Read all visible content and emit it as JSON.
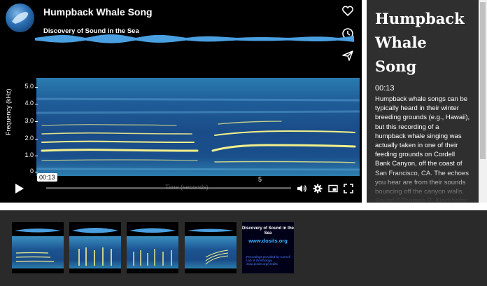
{
  "video": {
    "title": "Humpback Whale Song",
    "subtitle": "Discovery of Sound in the Sea",
    "y_axis_label": "Frequency (kHz)",
    "y_ticks": [
      "5.0",
      "4.0",
      "3.0",
      "2.0",
      "1.0",
      "0"
    ],
    "x_axis_label": "Time (seconds)",
    "x_tick": "5",
    "current_time": "00:13",
    "progress_fraction": 0.0
  },
  "icons": {
    "like": "heart-icon",
    "watch_later": "clock-icon",
    "share": "share-icon",
    "play": "play-icon",
    "volume": "volume-icon",
    "settings": "gear-icon",
    "miniplayer": "miniplayer-icon",
    "fullscreen": "fullscreen-icon"
  },
  "panel": {
    "title": "Humpback Whale Song",
    "time": "00:13",
    "description": "Humpback whale songs can be typically heard in their winter breeding grounds (e.g., Hawaii), but this recording of a humpback whale singing was actually taken in one of their feeding grounds on Cordell Bank Canyon, off the coast of San Francisco, CA. The echoes you hear are from their sounds bouncing off the canyon walls. Sound ©Thomas R. Kieckhefer. Released under Creative Commons License, Non-"
  },
  "playlist": {
    "logo": {
      "line1": "Discovery of Sound in the Sea",
      "line2": "www.dosits.org",
      "line3": "Recordings provided by Cornell Lab of Ornithology www.dosits.org/credits"
    }
  },
  "colors": {
    "player_bg": "#000000",
    "panel_bg": "#2f2f2f",
    "strip_bg": "#2a2a2a",
    "link_blue": "#3fb4ff"
  }
}
